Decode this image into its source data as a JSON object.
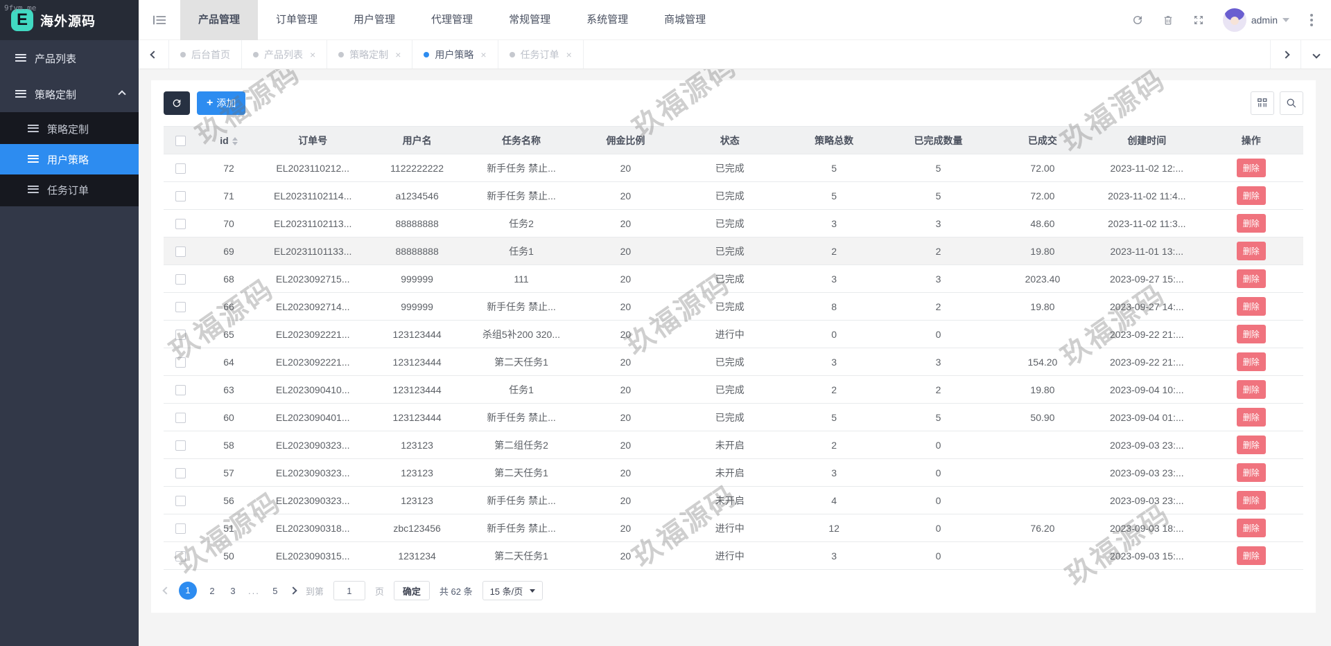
{
  "meta": {
    "watermark": "玖福源码",
    "corner_watermark": "9fym.me"
  },
  "sidebar": {
    "logo_letter": "E",
    "logo_text": "海外源码",
    "items": [
      {
        "label": "产品列表"
      },
      {
        "label": "策略定制"
      }
    ],
    "subitems": [
      {
        "label": "策略定制"
      },
      {
        "label": "用户策略"
      },
      {
        "label": "任务订单"
      }
    ]
  },
  "navbar": {
    "menus": [
      {
        "label": "产品管理"
      },
      {
        "label": "订单管理"
      },
      {
        "label": "用户管理"
      },
      {
        "label": "代理管理"
      },
      {
        "label": "常规管理"
      },
      {
        "label": "系统管理"
      },
      {
        "label": "商城管理"
      }
    ],
    "user": "admin"
  },
  "tabbar": {
    "tabs": [
      {
        "label": "后台首页"
      },
      {
        "label": "产品列表"
      },
      {
        "label": "策略定制"
      },
      {
        "label": "用户策略"
      },
      {
        "label": "任务订单"
      }
    ],
    "close_glyph": "×"
  },
  "toolbar": {
    "add_label": "添加",
    "plus_glyph": "+"
  },
  "table": {
    "columns": [
      "id",
      "订单号",
      "用户名",
      "任务名称",
      "佣金比例",
      "状态",
      "策略总数",
      "已完成数量",
      "已成交",
      "创建时间",
      "操作"
    ],
    "delete_label": "删除",
    "rows": [
      {
        "id": "72",
        "order_no": "EL2023110212...",
        "username": "1122222222",
        "task": "新手任务 禁止...",
        "commission": "20",
        "status": "已完成",
        "total": "5",
        "done": "5",
        "deal": "72.00",
        "created": "2023-11-02 12:...",
        "highlight": false
      },
      {
        "id": "71",
        "order_no": "EL20231102114...",
        "username": "a1234546",
        "task": "新手任务 禁止...",
        "commission": "20",
        "status": "已完成",
        "total": "5",
        "done": "5",
        "deal": "72.00",
        "created": "2023-11-02 11:4...",
        "highlight": false
      },
      {
        "id": "70",
        "order_no": "EL20231102113...",
        "username": "88888888",
        "task": "任务2",
        "commission": "20",
        "status": "已完成",
        "total": "3",
        "done": "3",
        "deal": "48.60",
        "created": "2023-11-02 11:3...",
        "highlight": false
      },
      {
        "id": "69",
        "order_no": "EL20231101133...",
        "username": "88888888",
        "task": "任务1",
        "commission": "20",
        "status": "已完成",
        "total": "2",
        "done": "2",
        "deal": "19.80",
        "created": "2023-11-01 13:...",
        "highlight": true
      },
      {
        "id": "68",
        "order_no": "EL2023092715...",
        "username": "999999",
        "task": "111",
        "commission": "20",
        "status": "已完成",
        "total": "3",
        "done": "3",
        "deal": "2023.40",
        "created": "2023-09-27 15:...",
        "highlight": false
      },
      {
        "id": "66",
        "order_no": "EL2023092714...",
        "username": "999999",
        "task": "新手任务 禁止...",
        "commission": "20",
        "status": "已完成",
        "total": "8",
        "done": "2",
        "deal": "19.80",
        "created": "2023-09-27 14:...",
        "highlight": false
      },
      {
        "id": "65",
        "order_no": "EL2023092221...",
        "username": "123123444",
        "task": "杀组5补200 320...",
        "commission": "20",
        "status": "进行中",
        "total": "0",
        "done": "0",
        "deal": "",
        "created": "2023-09-22 21:...",
        "highlight": false
      },
      {
        "id": "64",
        "order_no": "EL2023092221...",
        "username": "123123444",
        "task": "第二天任务1",
        "commission": "20",
        "status": "已完成",
        "total": "3",
        "done": "3",
        "deal": "154.20",
        "created": "2023-09-22 21:...",
        "highlight": false
      },
      {
        "id": "63",
        "order_no": "EL2023090410...",
        "username": "123123444",
        "task": "任务1",
        "commission": "20",
        "status": "已完成",
        "total": "2",
        "done": "2",
        "deal": "19.80",
        "created": "2023-09-04 10:...",
        "highlight": false
      },
      {
        "id": "60",
        "order_no": "EL2023090401...",
        "username": "123123444",
        "task": "新手任务 禁止...",
        "commission": "20",
        "status": "已完成",
        "total": "5",
        "done": "5",
        "deal": "50.90",
        "created": "2023-09-04 01:...",
        "highlight": false
      },
      {
        "id": "58",
        "order_no": "EL2023090323...",
        "username": "123123",
        "task": "第二组任务2",
        "commission": "20",
        "status": "未开启",
        "total": "2",
        "done": "0",
        "deal": "",
        "created": "2023-09-03 23:...",
        "highlight": false
      },
      {
        "id": "57",
        "order_no": "EL2023090323...",
        "username": "123123",
        "task": "第二天任务1",
        "commission": "20",
        "status": "未开启",
        "total": "3",
        "done": "0",
        "deal": "",
        "created": "2023-09-03 23:...",
        "highlight": false
      },
      {
        "id": "56",
        "order_no": "EL2023090323...",
        "username": "123123",
        "task": "新手任务 禁止...",
        "commission": "20",
        "status": "未开启",
        "total": "4",
        "done": "0",
        "deal": "",
        "created": "2023-09-03 23:...",
        "highlight": false
      },
      {
        "id": "51",
        "order_no": "EL2023090318...",
        "username": "zbc123456",
        "task": "新手任务 禁止...",
        "commission": "20",
        "status": "进行中",
        "total": "12",
        "done": "0",
        "deal": "76.20",
        "created": "2023-09-03 18:...",
        "highlight": false
      },
      {
        "id": "50",
        "order_no": "EL2023090315...",
        "username": "1231234",
        "task": "第二天任务1",
        "commission": "20",
        "status": "进行中",
        "total": "3",
        "done": "0",
        "deal": "",
        "created": "2023-09-03 15:...",
        "highlight": false
      }
    ]
  },
  "pagination": {
    "pages": [
      "1",
      "2",
      "3",
      "...",
      "5"
    ],
    "goto_label": "到第",
    "goto_value": "1",
    "page_label": "页",
    "confirm_label": "确定",
    "total_label": "共 62 条",
    "size_label": "15 条/页"
  }
}
